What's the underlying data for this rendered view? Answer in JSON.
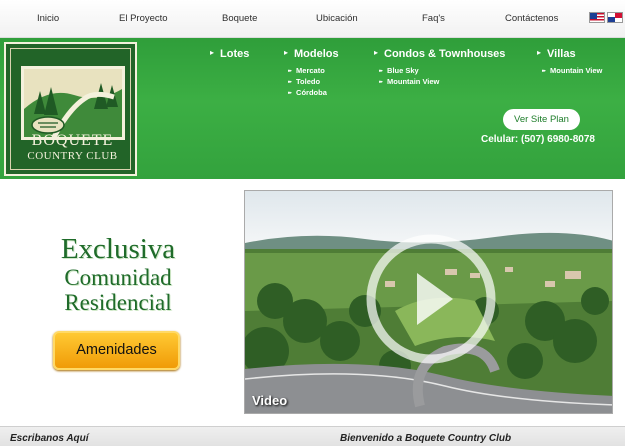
{
  "top_nav": {
    "items": [
      {
        "label": "Inicio"
      },
      {
        "label": "El Proyecto"
      },
      {
        "label": "Boquete"
      },
      {
        "label": "Ubicación"
      },
      {
        "label": "Faq's"
      },
      {
        "label": "Contáctenos"
      }
    ],
    "flags": [
      "us-flag-icon",
      "panama-flag-icon"
    ]
  },
  "logo": {
    "line1": "BOQUETE",
    "line2": "COUNTRY CLUB"
  },
  "main_menu": {
    "lotes": {
      "label": "Lotes"
    },
    "modelos": {
      "label": "Modelos",
      "items": [
        "Mercato",
        "Toledo",
        "Córdoba"
      ]
    },
    "condos": {
      "label": "Condos & Townhouses",
      "items": [
        "Blue Sky",
        "Mountain View"
      ]
    },
    "villas": {
      "label": "Villas",
      "items": [
        "Mountain View"
      ]
    }
  },
  "site_plan_button": "Ver Site Plan",
  "phone": "Celular: (507) 6980-8078",
  "hero": {
    "line1": "Exclusiva",
    "line2": "Comunidad",
    "line3": "Residencial",
    "amenities_button": "Amenidades"
  },
  "video": {
    "label": "Video",
    "play_icon": "play-icon"
  },
  "footer": {
    "left": "Escribanos Aquí",
    "right": "Bienvenido a Boquete Country Club"
  },
  "colors": {
    "header_green": "#3caf44",
    "logo_green": "#226428",
    "amenities_orange": "#f5a91c"
  }
}
